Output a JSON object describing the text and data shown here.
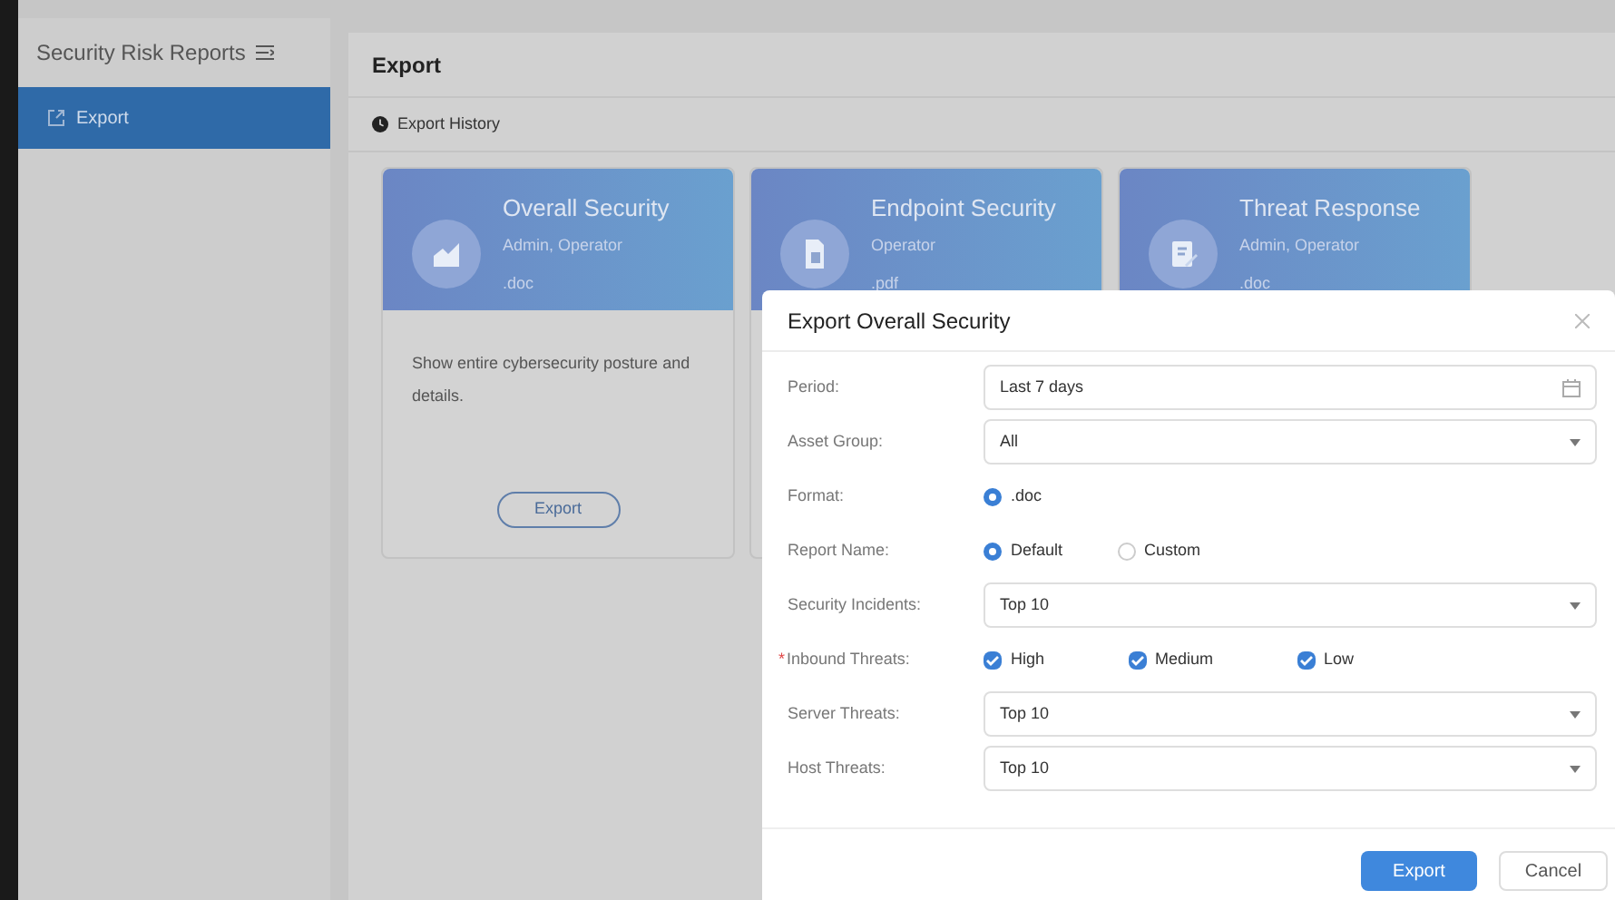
{
  "sidebar": {
    "title": "Security Risk Reports",
    "items": [
      {
        "label": "Export",
        "selected": true
      }
    ]
  },
  "main": {
    "title": "Export",
    "history_link": "Export History"
  },
  "cards": [
    {
      "title": "Overall Security",
      "roles": "Admin, Operator",
      "format": ".doc",
      "kind": "chart",
      "description": "Show entire cybersecurity posture and details.",
      "button": "Export"
    },
    {
      "title": "Endpoint Security",
      "roles": "Operator",
      "format": ".pdf",
      "kind": "document"
    },
    {
      "title": "Threat Response",
      "roles": "Admin, Operator",
      "format": ".doc",
      "kind": "edit"
    }
  ],
  "dialog": {
    "title": "Export Overall Security",
    "fields": [
      {
        "kind": "date",
        "label": "Period:",
        "value": "Last 7 days"
      },
      {
        "kind": "select",
        "label": "Asset Group:",
        "value": "All"
      },
      {
        "kind": "radio",
        "label": "Format:",
        "options": [
          {
            "label": ".doc",
            "selected": true
          }
        ]
      },
      {
        "kind": "radio",
        "label": "Report Name:",
        "options": [
          {
            "label": "Default",
            "selected": true
          },
          {
            "label": "Custom",
            "selected": false
          }
        ]
      },
      {
        "kind": "select",
        "label": "Security Incidents:",
        "value": "Top 10"
      },
      {
        "kind": "checkbox",
        "label": "Inbound Threats:",
        "required_mark": "*",
        "options": [
          {
            "label": "High",
            "checked": true
          },
          {
            "label": "Medium",
            "checked": true
          },
          {
            "label": "Low",
            "checked": true
          }
        ]
      },
      {
        "kind": "select",
        "label": "Server Threats:",
        "value": "Top 10"
      },
      {
        "kind": "select",
        "label": "Host Threats:",
        "value": "Top 10"
      }
    ],
    "buttons": [
      {
        "label": "Export",
        "kind": "primary"
      },
      {
        "label": "Cancel",
        "kind": "secondary"
      }
    ]
  }
}
